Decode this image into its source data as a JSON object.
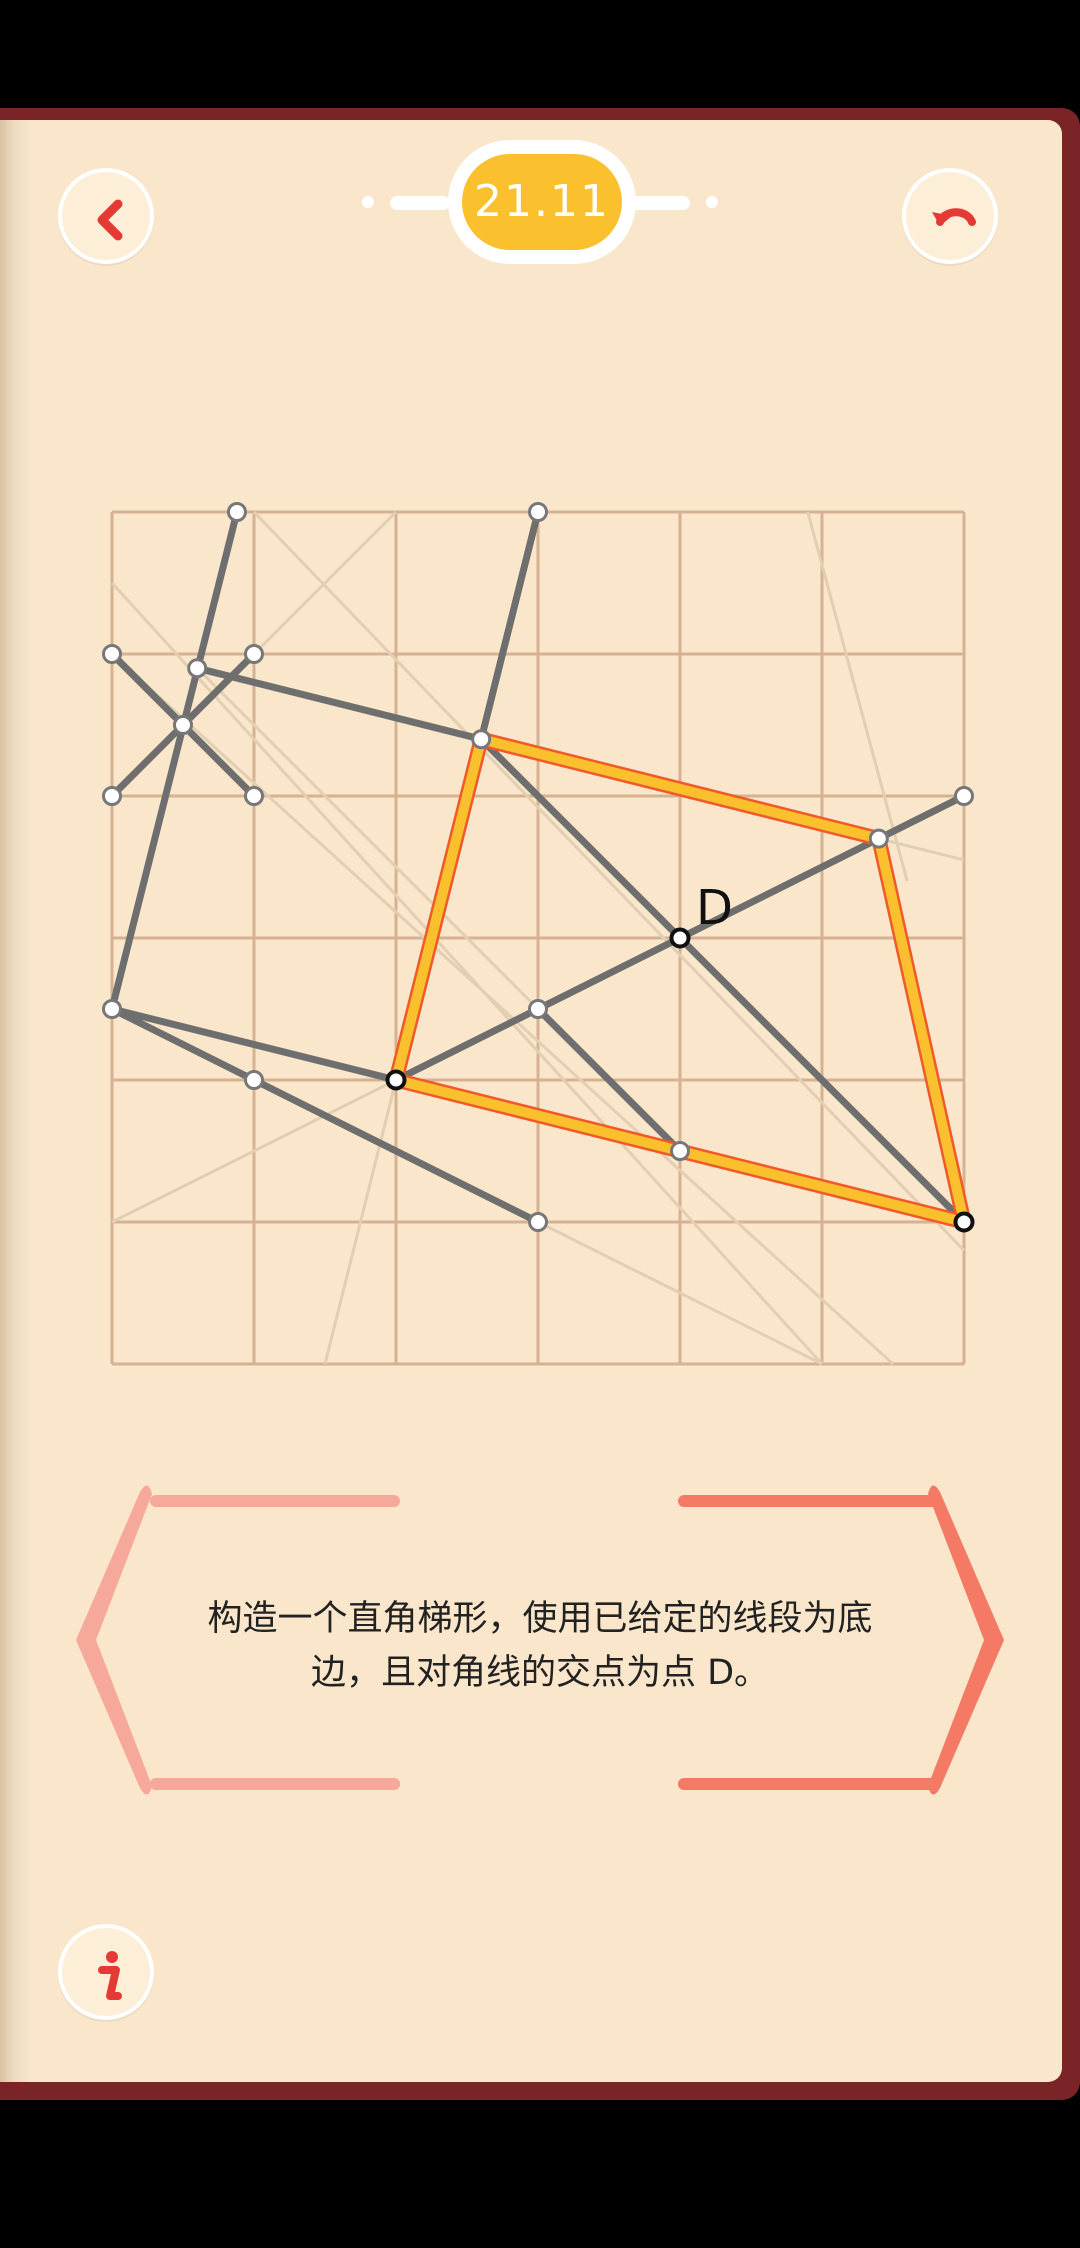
{
  "header": {
    "level": "21.11",
    "back_icon": "chevron-left-icon",
    "undo_icon": "undo-arrow-icon"
  },
  "colors": {
    "page": "#fae6ca",
    "grid": "#d4b293",
    "line": "#6e6e6e",
    "faint_line": "#e2cfb3",
    "highlight": "#fbc02d",
    "highlight_edge": "#f05a2a",
    "accent_red": "#e53935",
    "frame_left": "#f6a99a",
    "frame_right": "#f47a66",
    "book": "#7a2428"
  },
  "puzzle": {
    "grid": {
      "cols": 6,
      "rows": 6
    },
    "point_label": "D",
    "points": [
      {
        "x": 0.88,
        "y": 0
      },
      {
        "x": 3,
        "y": 0
      },
      {
        "x": 0,
        "y": 1
      },
      {
        "x": 1,
        "y": 1
      },
      {
        "x": 0.6,
        "y": 1.1
      },
      {
        "x": 0.5,
        "y": 1.5
      },
      {
        "x": 0,
        "y": 2
      },
      {
        "x": 1,
        "y": 2
      },
      {
        "x": 2.6,
        "y": 1.6
      },
      {
        "x": 6,
        "y": 2
      },
      {
        "x": 5.4,
        "y": 2.3
      },
      {
        "x": 4,
        "y": 3
      },
      {
        "x": 0,
        "y": 3.5
      },
      {
        "x": 3,
        "y": 3.5
      },
      {
        "x": 1,
        "y": 4
      },
      {
        "x": 2,
        "y": 4
      },
      {
        "x": 4,
        "y": 4.5
      },
      {
        "x": 3,
        "y": 5
      },
      {
        "x": 6,
        "y": 5
      }
    ],
    "gray_lines": [
      [
        [
          0.88,
          0
        ],
        [
          0,
          3.5
        ]
      ],
      [
        [
          3,
          0
        ],
        [
          2.6,
          1.6
        ]
      ],
      [
        [
          0,
          1
        ],
        [
          1,
          2
        ]
      ],
      [
        [
          1,
          1
        ],
        [
          0,
          2
        ]
      ],
      [
        [
          0.6,
          1.1
        ],
        [
          2.6,
          1.6
        ]
      ],
      [
        [
          0,
          3.5
        ],
        [
          2,
          4
        ]
      ],
      [
        [
          0,
          3.5
        ],
        [
          3,
          5
        ]
      ],
      [
        [
          2,
          4
        ],
        [
          6,
          2
        ]
      ],
      [
        [
          2.6,
          1.6
        ],
        [
          6,
          5
        ]
      ],
      [
        [
          3,
          3.5
        ],
        [
          4,
          4.5
        ]
      ]
    ],
    "faint_lines": [
      [
        [
          1,
          0
        ],
        [
          6,
          5.2
        ]
      ],
      [
        [
          0,
          0.5
        ],
        [
          5,
          6
        ]
      ],
      [
        [
          0,
          1
        ],
        [
          5.5,
          6
        ]
      ],
      [
        [
          0,
          2
        ],
        [
          2,
          0
        ]
      ],
      [
        [
          4.9,
          0
        ],
        [
          5.6,
          2.6
        ]
      ],
      [
        [
          0,
          5
        ],
        [
          2,
          4
        ]
      ],
      [
        [
          1.5,
          6
        ],
        [
          2,
          4
        ]
      ],
      [
        [
          5.4,
          2.3
        ],
        [
          6,
          2.45
        ]
      ],
      [
        [
          3,
          5
        ],
        [
          5,
          6
        ]
      ],
      [
        [
          0.6,
          1.1
        ],
        [
          3,
          3.5
        ]
      ]
    ],
    "highlight_polygon": [
      [
        2.6,
        1.6
      ],
      [
        5.4,
        2.3
      ],
      [
        6,
        5
      ],
      [
        2,
        4
      ]
    ],
    "dark_points": [
      [
        4,
        3
      ],
      [
        2,
        4
      ],
      [
        6,
        5
      ]
    ]
  },
  "instruction": {
    "line1": "构造一个直角梯形，使用已给定的线段为底",
    "line2": "边，且对角线的交点为点 D。"
  },
  "footer": {
    "info_icon": "info-icon"
  }
}
